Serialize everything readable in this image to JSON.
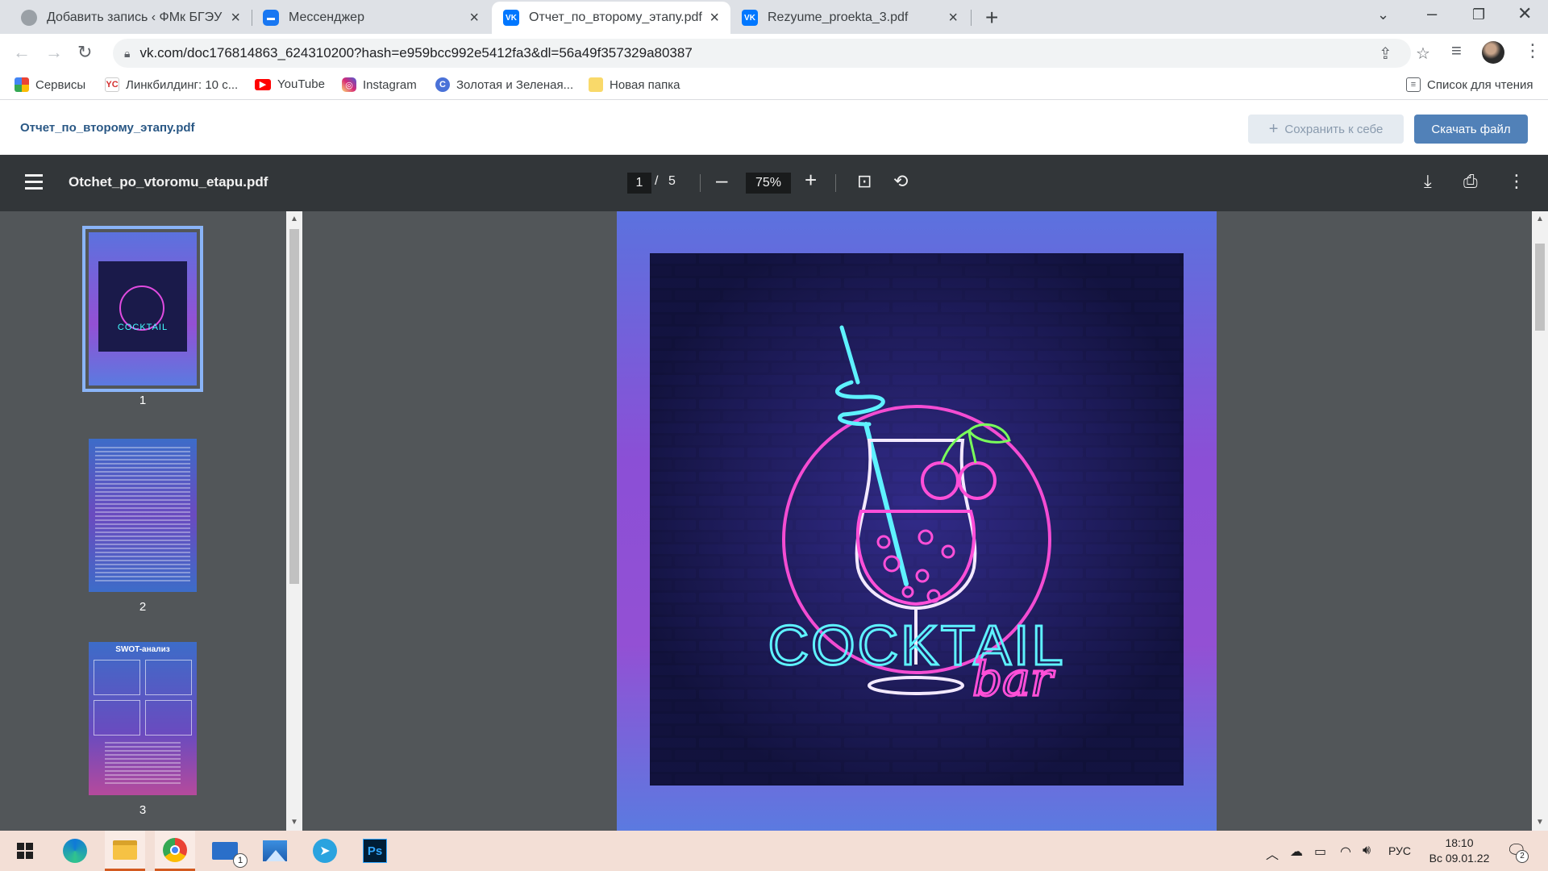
{
  "browser": {
    "tabs": [
      {
        "title": "Добавить запись ‹ ФМк БГЭУ — ",
        "favicon": "globe-icon"
      },
      {
        "title": "Мессенджер",
        "favicon": "messenger-icon"
      },
      {
        "title": "Отчет_по_второму_этапу.pdf",
        "favicon": "vk-icon",
        "active": true
      },
      {
        "title": "Rezyume_proekta_3.pdf",
        "favicon": "vk-icon"
      }
    ],
    "url": "vk.com/doc176814863_624310200?hash=e959bcc992e5412fa3&dl=56a49f357329a80387",
    "bookmarks": [
      {
        "label": "Сервисы",
        "icon": "apps-grid-icon"
      },
      {
        "label": "Линкбилдинг: 10 с...",
        "icon": "site-icon"
      },
      {
        "label": "YouTube",
        "icon": "youtube-icon"
      },
      {
        "label": "Instagram",
        "icon": "instagram-icon"
      },
      {
        "label": "Золотая и Зеленая...",
        "icon": "site-icon"
      },
      {
        "label": "Новая папка",
        "icon": "folder-icon"
      }
    ],
    "reading_list": "Список для чтения"
  },
  "vk": {
    "doc_title": "Отчет_по_второму_этапу.pdf",
    "save_label": "Сохранить к себе",
    "download_label": "Скачать файл"
  },
  "pdf": {
    "filename": "Otchet_po_vtoromu_etapu.pdf",
    "current_page": "1",
    "page_sep": "/",
    "total_pages": "5",
    "zoom": "75%",
    "thumbnails": [
      {
        "num": "1"
      },
      {
        "num": "2"
      },
      {
        "num": "3",
        "heading": "SWOT-анализ"
      }
    ]
  },
  "artwork": {
    "word1": "COCKTAIL",
    "word2": "bar"
  },
  "taskbar": {
    "mail_badge": "1",
    "photoshop_label": "Ps",
    "language": "РУС",
    "time": "18:10",
    "date": "Вс 09.01.22",
    "notifications": "2"
  }
}
